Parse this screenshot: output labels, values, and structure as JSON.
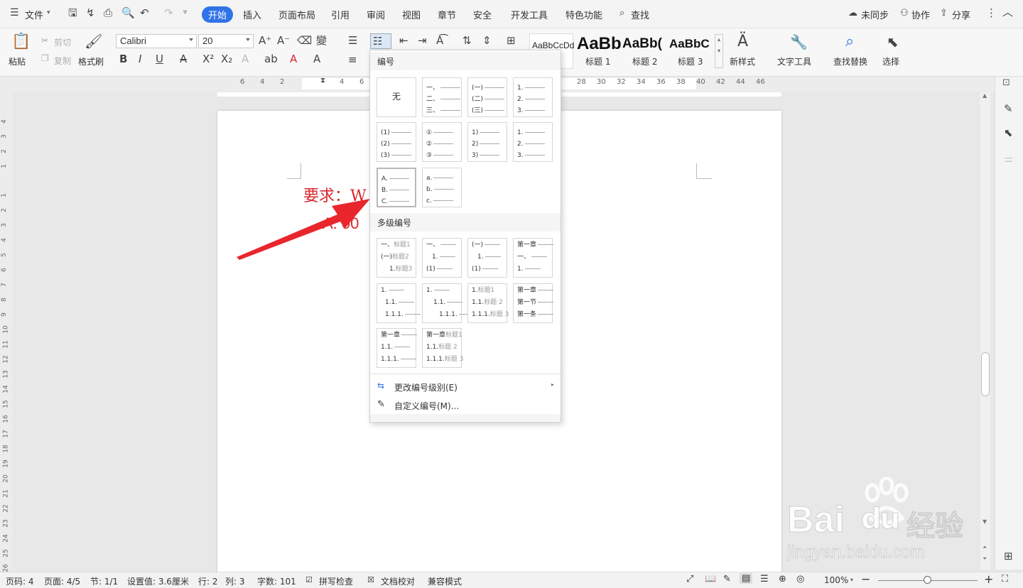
{
  "topbar": {
    "menu": "文件",
    "tabs": [
      "开始",
      "插入",
      "页面布局",
      "引用",
      "审阅",
      "视图",
      "章节",
      "安全",
      "开发工具",
      "特色功能"
    ],
    "search": "查找",
    "sync": "未同步",
    "collab": "协作",
    "share": "分享"
  },
  "ribbon": {
    "paste": "粘贴",
    "cut": "剪切",
    "copy": "复制",
    "format_painter": "格式刷",
    "font_name": "Calibri",
    "font_size": "20",
    "styles": [
      {
        "preview": "AaBbCcDd",
        "label": ""
      },
      {
        "preview": "AaBb",
        "label": "标题 1"
      },
      {
        "preview": "AaBb(",
        "label": "标题 2"
      },
      {
        "preview": "AaBbC",
        "label": "标题 3"
      }
    ],
    "new_style": "新样式",
    "text_tools": "文字工具",
    "find_replace": "查找替换",
    "select": "选择"
  },
  "ruler": {
    "left_ticks": [
      "6",
      "4",
      "2"
    ],
    "ticks": [
      "2",
      "4",
      "6"
    ],
    "right_ticks": [
      "28",
      "30",
      "32",
      "34",
      "36",
      "38",
      "40",
      "42",
      "44",
      "46"
    ]
  },
  "vruler": {
    "ticks": [
      "4",
      "3",
      "2",
      "1",
      "1",
      "2",
      "3",
      "4",
      "5",
      "6",
      "7",
      "8",
      "9",
      "10",
      "11",
      "12",
      "13",
      "14",
      "15",
      "16",
      "17",
      "18",
      "19",
      "20",
      "21",
      "22",
      "23",
      "24",
      "25",
      "26"
    ]
  },
  "doc": {
    "line1": "要求：W",
    "line2": "A. 00"
  },
  "dropdown": {
    "numbering_title": "编号",
    "none_label": "无",
    "multilevel_title": "多级编号",
    "change_level": "更改编号级别(E)",
    "custom": "自定义编号(M)...",
    "single": [
      [],
      [
        "一、",
        "二、",
        "三、"
      ],
      [
        "(一)",
        "(二)",
        "(三)"
      ],
      [
        "1.",
        "2.",
        "3."
      ],
      [
        "(1)",
        "(2)",
        "(3)"
      ],
      [
        "①",
        "②",
        "③"
      ],
      [
        "1)",
        "2)",
        "3)"
      ],
      [
        "1.",
        "2.",
        "3."
      ],
      [
        "A.",
        "B.",
        "C."
      ],
      [
        "a.",
        "b.",
        "c."
      ]
    ],
    "multi": [
      [
        [
          "一、",
          "标题1"
        ],
        [
          "(一)",
          "标题2"
        ],
        [
          "1.",
          "标题3"
        ]
      ],
      [
        [
          "一、",
          ""
        ],
        [
          "1.",
          ""
        ],
        [
          "(1)",
          ""
        ]
      ],
      [
        [
          "(一)",
          ""
        ],
        [
          "1.",
          ""
        ],
        [
          "(1)",
          ""
        ]
      ],
      [
        [
          "第一章",
          ""
        ],
        [
          "一、",
          ""
        ],
        [
          "1.",
          ""
        ]
      ],
      [
        [
          "1.",
          ""
        ],
        [
          "1.1.",
          ""
        ],
        [
          "1.1.1.",
          ""
        ]
      ],
      [
        [
          "1.",
          ""
        ],
        [
          "1.1.",
          ""
        ],
        [
          "1.1.1.",
          ""
        ]
      ],
      [
        [
          "1.",
          "标题1"
        ],
        [
          "1.1.",
          "标题 2"
        ],
        [
          "1.1.1.",
          "标题 3"
        ]
      ],
      [
        [
          "第一章",
          ""
        ],
        [
          "第一节",
          ""
        ],
        [
          "第一条",
          ""
        ]
      ],
      [
        [
          "第一章",
          ""
        ],
        [
          "1.1.",
          ""
        ],
        [
          "1.1.1.",
          ""
        ]
      ],
      [
        [
          "第一章",
          "标题1"
        ],
        [
          "1.1.",
          "标题 2"
        ],
        [
          "1.1.1.",
          "标题 3"
        ]
      ]
    ]
  },
  "status": {
    "page": "页码: 4",
    "pages": "页面: 4/5",
    "section": "节: 1/1",
    "setting": "设置值: 3.6厘米",
    "row": "行: 2",
    "col": "列: 3",
    "words": "字数: 101",
    "spell": "拼写检查",
    "proof": "文档校对",
    "compat": "兼容模式",
    "zoom": "100%"
  },
  "watermark": {
    "brand": "Bai",
    "brand2": "经验",
    "url": "jingyan.baidu.com"
  },
  "colors": {
    "accent": "#2f73e8",
    "doc_text": "#d9262c",
    "arrow": "#e8262c"
  }
}
